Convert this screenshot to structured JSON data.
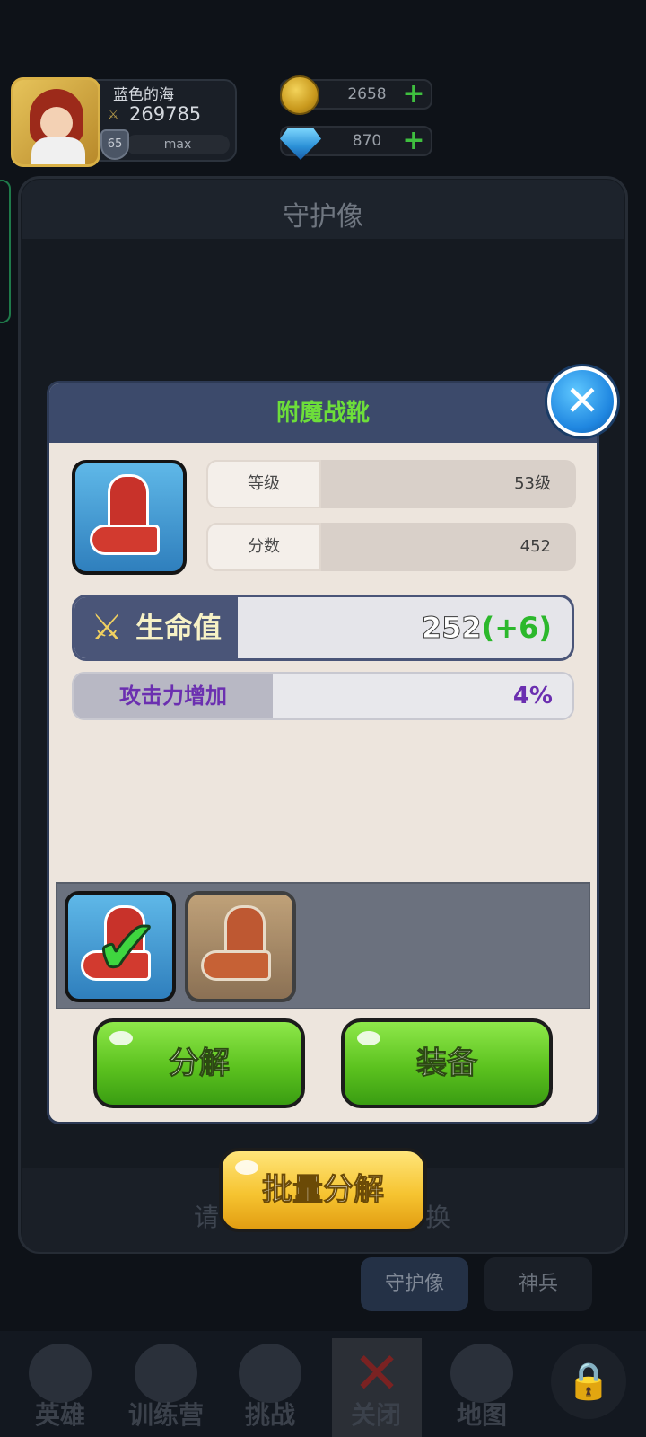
{
  "player": {
    "name": "蓝色的海",
    "power": "269785",
    "level": "65",
    "exp_label": "max"
  },
  "resources": {
    "gold": "2658",
    "diamond": "870"
  },
  "panel": {
    "title": "守护像",
    "hint_left": "请",
    "hint_right": "换"
  },
  "tabs": [
    {
      "label": "守护像"
    },
    {
      "label": "神兵"
    }
  ],
  "dialog": {
    "title": "附魔战靴",
    "stats": [
      {
        "label": "等级",
        "value": "53级"
      },
      {
        "label": "分数",
        "value": "452"
      }
    ],
    "main_stat": {
      "label": "生命值",
      "value": "252",
      "bonus": "(+6)"
    },
    "sub_stat": {
      "label": "攻击力增加",
      "value": "4%"
    },
    "decompose_label": "分解",
    "equip_label": "装备"
  },
  "batch_decompose_label": "批量分解",
  "nav": [
    {
      "label": "英雄"
    },
    {
      "label": "训练营"
    },
    {
      "label": "挑战"
    },
    {
      "label": "关闭"
    },
    {
      "label": "地图"
    }
  ],
  "colors": {
    "dialog_title": "#6dde3a",
    "bonus_green": "#2cb82c",
    "sub_stat_purple": "#6b2fb0",
    "button_green": "#5cc21f",
    "button_yellow": "#f6c431"
  },
  "icons": [
    "coin-icon",
    "diamond-icon",
    "plus-icon",
    "close-icon",
    "sword-icon",
    "boot-icon",
    "check-icon",
    "lock-icon",
    "shield-icon"
  ]
}
